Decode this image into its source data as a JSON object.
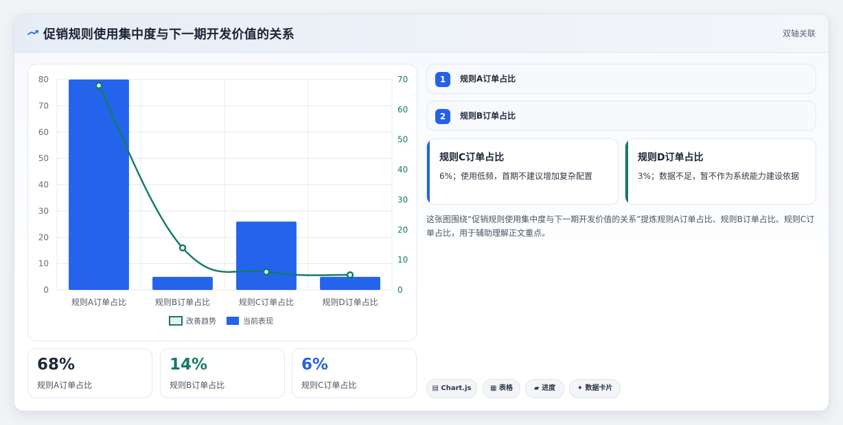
{
  "header": {
    "title": "促销规则使用集中度与下一期开发价值的关系",
    "tag": "双轴关联"
  },
  "chart_data": {
    "type": "bar",
    "categories": [
      "规则A订单占比",
      "规则B订单占比",
      "规则C订单占比",
      "规则D订单占比"
    ],
    "series": [
      {
        "name": "当前表现",
        "type": "bar",
        "axis": "left",
        "values": [
          80,
          5,
          26,
          5
        ],
        "color": "#2563eb"
      },
      {
        "name": "改善趋势",
        "type": "line",
        "axis": "right",
        "values": [
          68,
          14,
          6,
          5
        ],
        "color": "#137a68"
      }
    ],
    "ylim_left": [
      0,
      80
    ],
    "yticks_left": [
      "0",
      "10",
      "20",
      "30",
      "40",
      "50",
      "60",
      "70",
      "80"
    ],
    "ylim_right": [
      0,
      70
    ],
    "yticks_right": [
      "0",
      "10",
      "20",
      "30",
      "40",
      "50",
      "60",
      "70"
    ],
    "grid": true,
    "legend": "bottom"
  },
  "kpis": [
    {
      "value": "68%",
      "label": "规则A订单占比",
      "color": "#1f2937"
    },
    {
      "value": "14%",
      "label": "规则B订单占比",
      "color": "#137a68"
    },
    {
      "value": "6%",
      "label": "规则C订单占比",
      "color": "#2461e8"
    }
  ],
  "rules": [
    {
      "num": "1",
      "label": "规则A订单占比"
    },
    {
      "num": "2",
      "label": "规则B订单占比"
    }
  ],
  "details": [
    {
      "title": "规则C订单占比",
      "desc": "6%；使用低频，首期不建议增加复杂配置",
      "accent": "#2461e8"
    },
    {
      "title": "规则D订单占比",
      "desc": "3%；数据不足，暂不作为系统能力建设依据",
      "accent": "#137a68"
    }
  ],
  "description": "这张图围绕“促销规则使用集中度与下一期开发价值的关系”提炼规则A订单占比、规则B订单占比、规则C订单占比，用于辅助理解正文重点。",
  "chips": [
    {
      "icon": "▤",
      "label": "Chart.js"
    },
    {
      "icon": "▦",
      "label": "表格"
    },
    {
      "icon": "▰",
      "label": "进度"
    },
    {
      "icon": "✦",
      "label": "数据卡片"
    }
  ]
}
